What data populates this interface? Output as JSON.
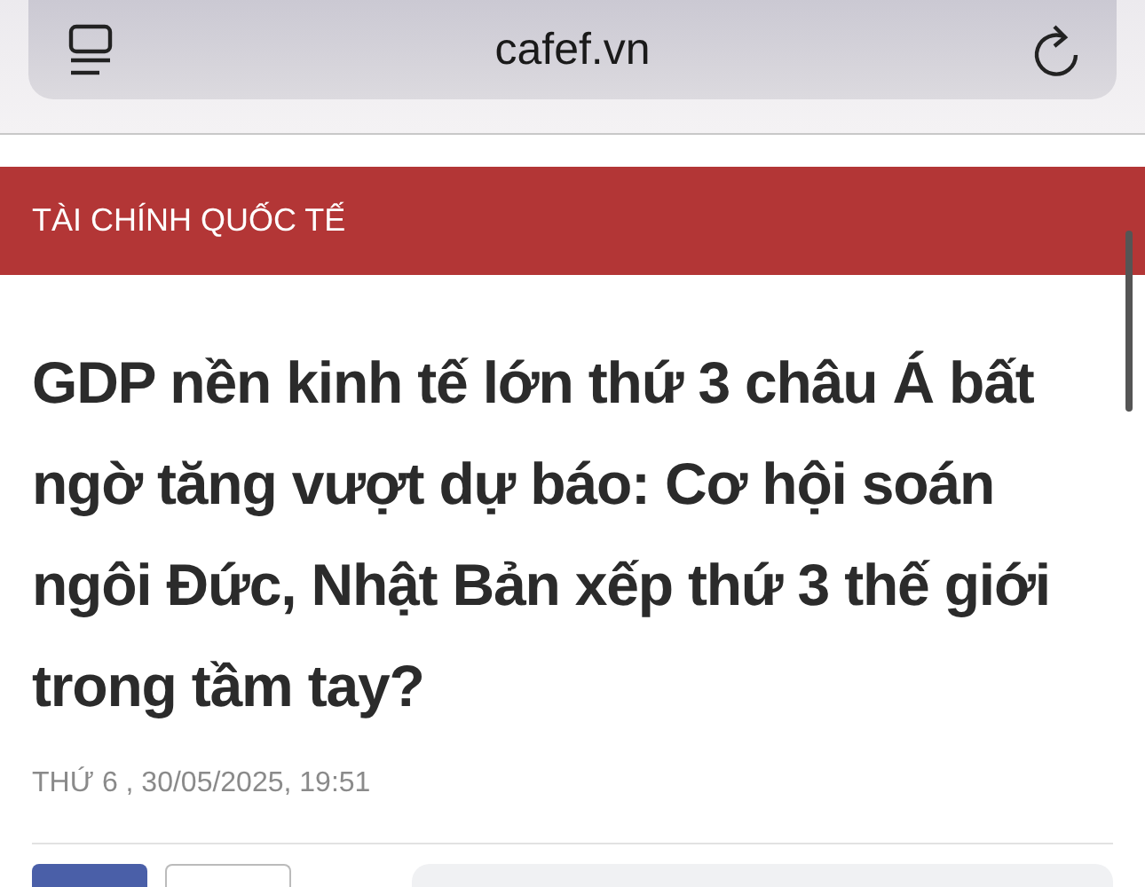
{
  "browser": {
    "url": "cafef.vn"
  },
  "category": "TÀI CHÍNH QUỐC TẾ",
  "article": {
    "title": "GDP nền kinh tế lớn thứ 3 châu Á bất ngờ tăng vượt dự báo: Cơ hội soán ngôi Đức, Nhật Bản xếp thứ 3 thế giới trong tầm tay?",
    "date": "THỨ 6 , 30/05/2025, 19:51"
  }
}
